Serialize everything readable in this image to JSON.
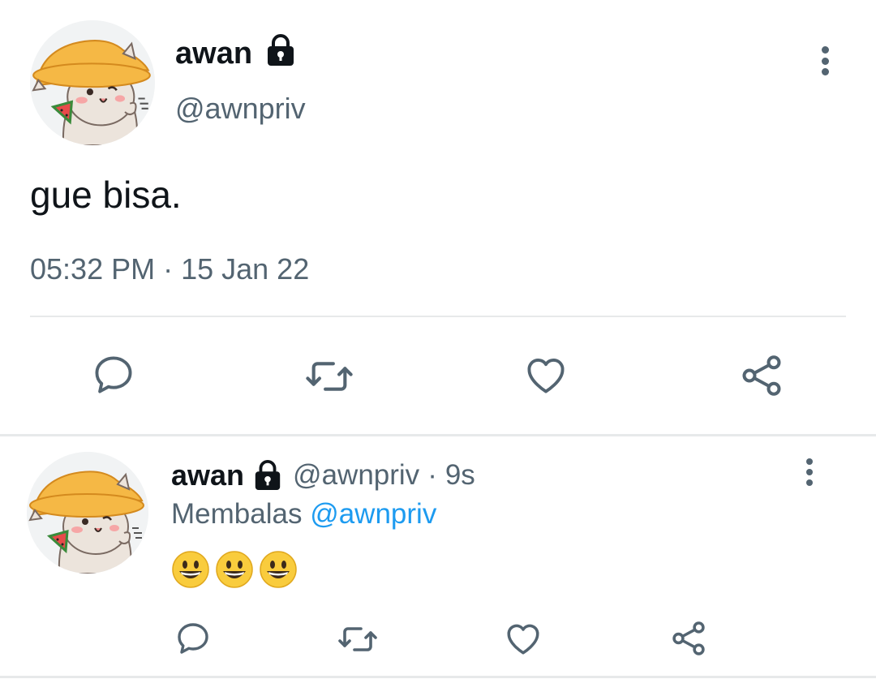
{
  "main_tweet": {
    "display_name": "awan",
    "handle": "@awnpriv",
    "text": "gue bisa.",
    "timestamp": "05:32 PM · 15 Jan 22",
    "lock_icon": "lock-icon",
    "actions": [
      "reply-icon",
      "retweet-icon",
      "like-icon",
      "share-icon"
    ]
  },
  "reply_tweet": {
    "display_name": "awan",
    "handle": "@awnpriv",
    "separator": "·",
    "time_ago": "9s",
    "replying_label": "Membalas",
    "replying_to": "@awnpriv",
    "emojis": [
      "😀",
      "😀",
      "😀"
    ],
    "actions": [
      "reply-icon",
      "retweet-icon",
      "like-icon",
      "share-icon"
    ]
  },
  "colors": {
    "text_primary": "#0f1419",
    "text_secondary": "#536471",
    "link": "#1d9bf0",
    "divider": "#e7e9ea"
  }
}
